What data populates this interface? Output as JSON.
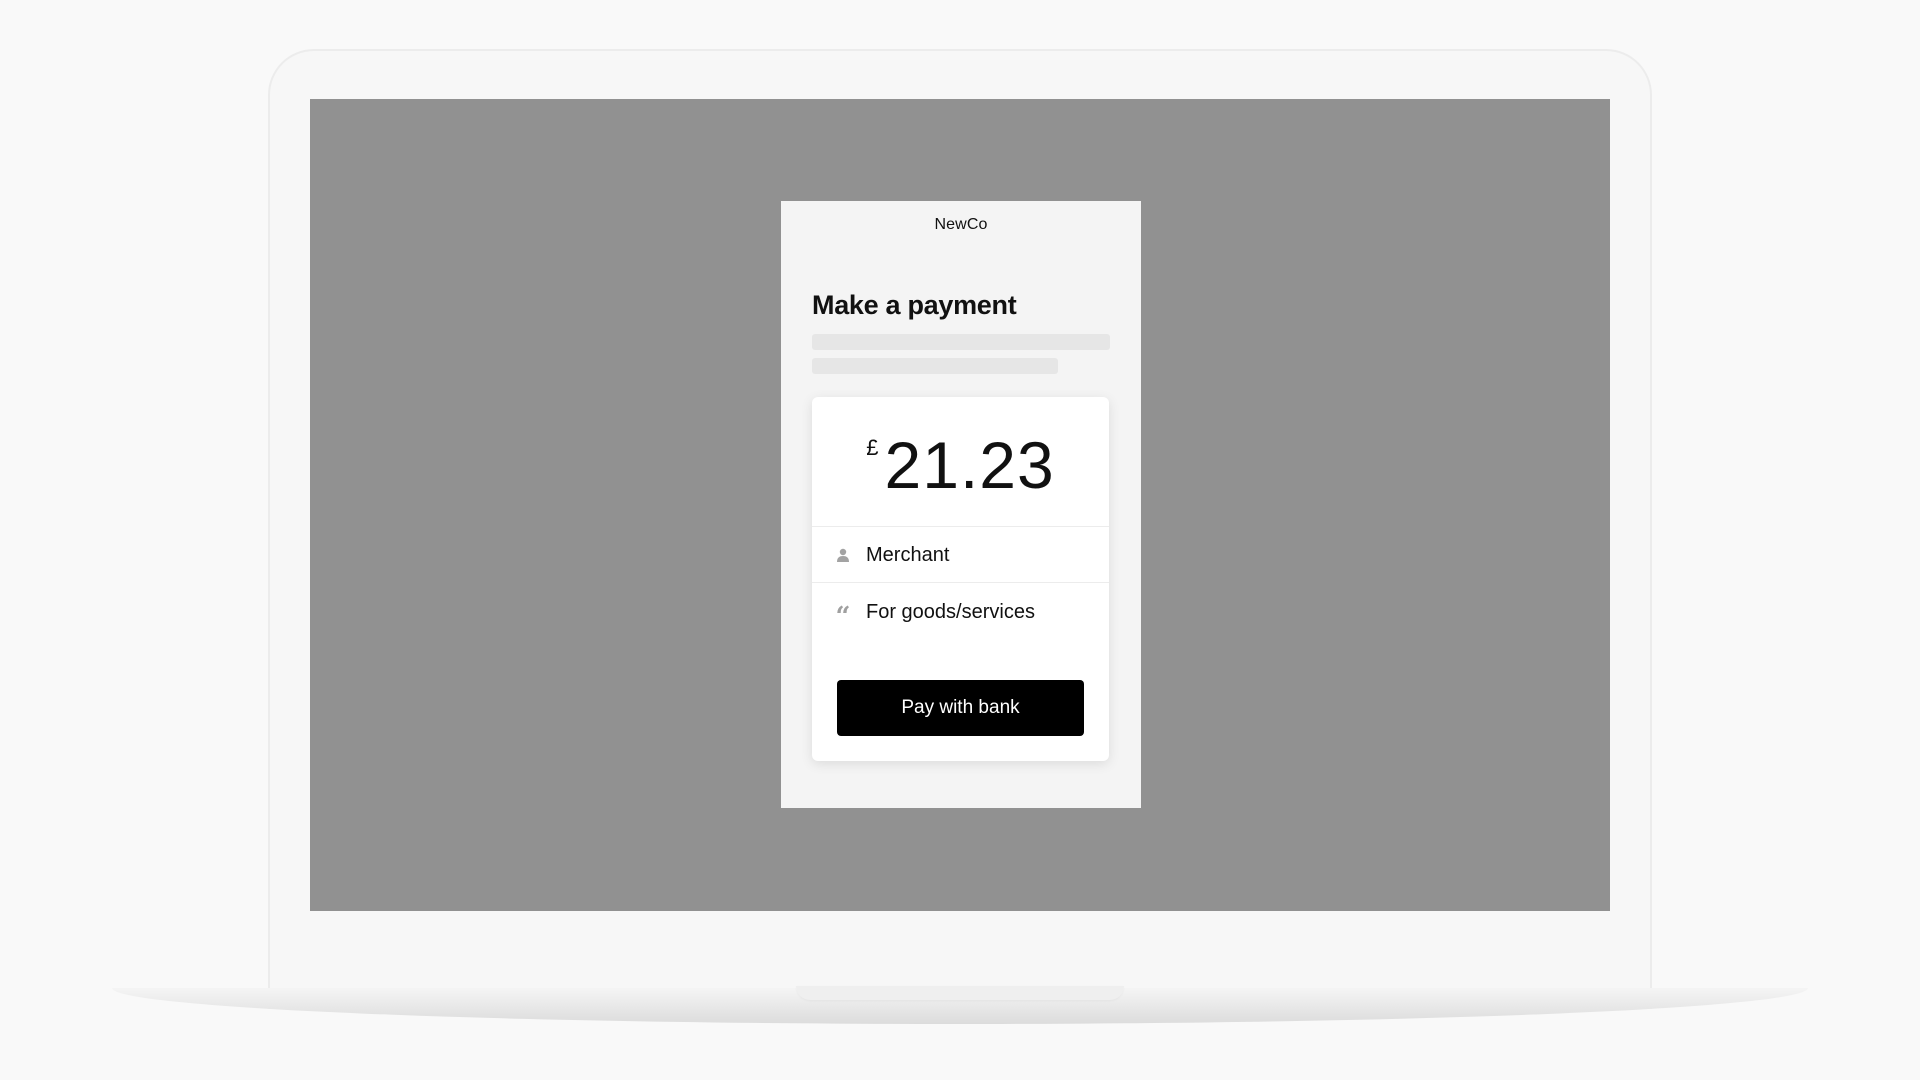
{
  "page": {
    "brand": "NewCo",
    "title": "Make a payment"
  },
  "payment": {
    "currency_symbol": "£",
    "amount": "21.23",
    "payee_icon": "person-icon",
    "payee": "Merchant",
    "reference_icon": "quote-icon",
    "reference": "For goods/services",
    "pay_button_label": "Pay with bank"
  },
  "colors": {
    "screen_background": "#919191",
    "panel_background": "#f4f4f4",
    "button_background": "#000000",
    "button_text": "#ffffff"
  }
}
